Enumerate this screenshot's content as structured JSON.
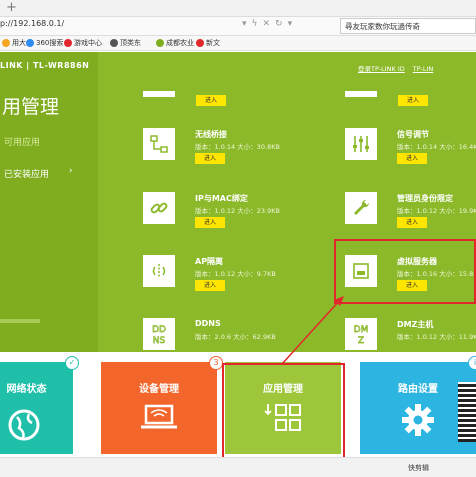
{
  "browser": {
    "new_tab": "+",
    "url": "p://192.168.0.1/",
    "search_text": "尋友玩家数你玩過传奇",
    "bookmarks": [
      {
        "label": "用大全",
        "color": "#f5a623"
      },
      {
        "label": "360搜索",
        "color": "#2d8cf0"
      },
      {
        "label": "游戏中心",
        "color": "#e2272c"
      },
      {
        "label": "顶类东",
        "color": "#555"
      },
      {
        "label": "成都农业",
        "color": "#7fad1f"
      },
      {
        "label": "新文",
        "color": "#e2272c"
      }
    ],
    "status": "快剪辑"
  },
  "router": {
    "brand": "LINK | TL-WR886N",
    "title": "用管理",
    "menu_available": "可用应用",
    "menu_installed": "已安装应用",
    "menu_arrow": "›",
    "top_links": [
      "登录TP-LINK ID",
      "TP-LIN"
    ],
    "enter_label": "进入",
    "apps": [
      {
        "name": "无线桥接",
        "meta": "版本：1.0.14 大小：30.8KB",
        "icon": "bridge-icon"
      },
      {
        "name": "信号调节",
        "meta": "版本：1.0.14 大小：16.4K",
        "icon": "signal-adjust-icon"
      },
      {
        "name": "IP与MAC绑定",
        "meta": "版本：1.0.12 大小：23.9KB",
        "icon": "link-icon"
      },
      {
        "name": "管理员身份限定",
        "meta": "版本：1.0.12 大小：19.9K",
        "icon": "wrench-icon"
      },
      {
        "name": "AP隔离",
        "meta": "版本：1.0.12 大小：9.7KB",
        "icon": "ap-isolation-icon"
      },
      {
        "name": "虚拟服务器",
        "meta": "版本：1.0.16 大小：15.8K",
        "icon": "virtual-server-icon"
      },
      {
        "name": "DDNS",
        "meta": "版本：2.0.6 大小：62.9KB",
        "icon": "ddns-icon"
      },
      {
        "name": "DMZ主机",
        "meta": "版本：1.0.12 大小：11.9K",
        "icon": "dmz-icon"
      }
    ]
  },
  "dock": {
    "tiles": [
      {
        "label": "网络状态",
        "color": "#1fbfaa",
        "badge": "✓"
      },
      {
        "label": "设备管理",
        "color": "#f2662c",
        "badge": "3"
      },
      {
        "label": "应用管理",
        "color": "#9dc63a",
        "badge": ""
      },
      {
        "label": "路由设置",
        "color": "#2cb5e0",
        "badge": "i"
      }
    ]
  }
}
